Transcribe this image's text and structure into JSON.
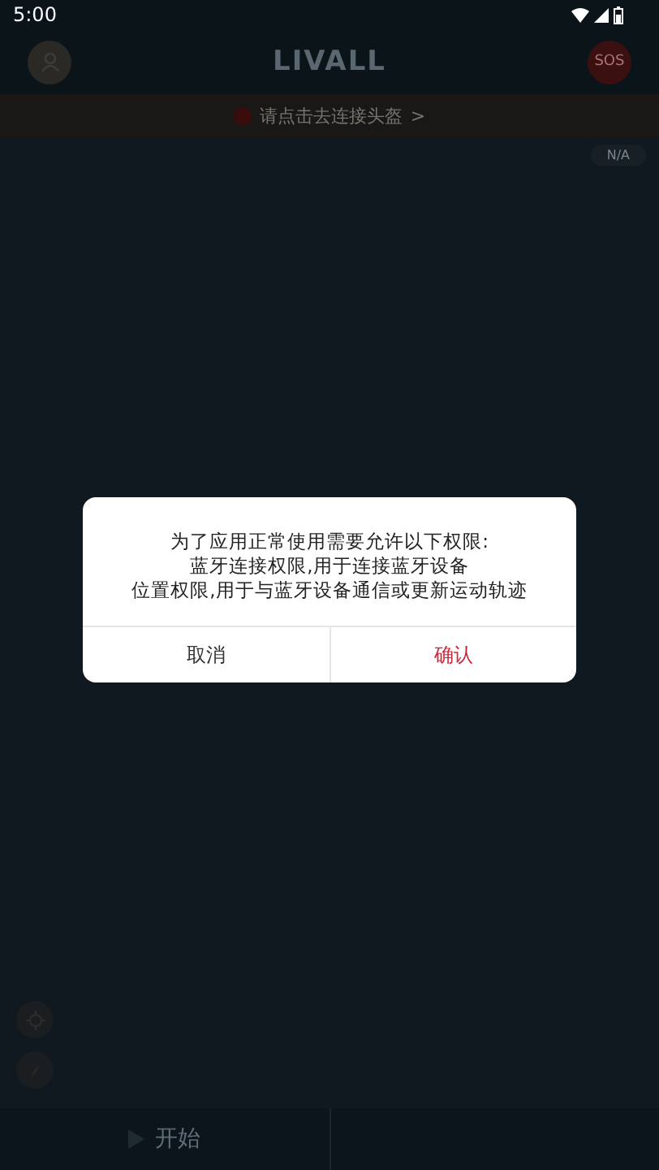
{
  "status_bar": {
    "time": "5:00"
  },
  "header": {
    "logo": "LIVALL",
    "sos": "SOS"
  },
  "banner": {
    "text": "请点击去连接头盔",
    "arrow": ">"
  },
  "map": {
    "badge": "N/A"
  },
  "bottom_bar": {
    "start": "开始"
  },
  "dialog": {
    "lines": [
      "为了应用正常使用需要允许以下权限:",
      "蓝牙连接权限,用于连接蓝牙设备",
      "位置权限,用于与蓝牙设备通信或更新运动轨迹"
    ],
    "buttons": [
      {
        "label": "取消",
        "kind": "cancel"
      },
      {
        "label": "确认",
        "kind": "confirm"
      }
    ]
  }
}
